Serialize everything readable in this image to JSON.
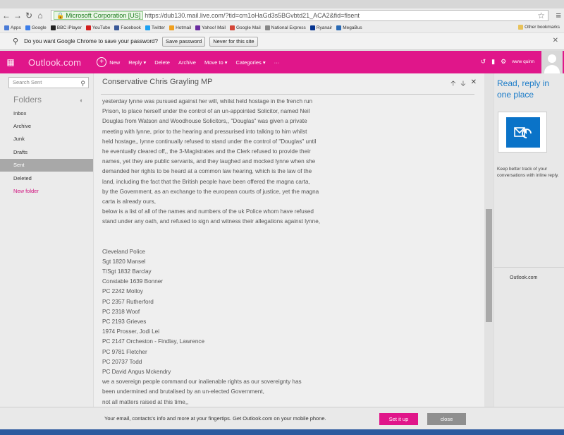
{
  "browser": {
    "ev_label": "Microsoft Corporation [US]",
    "url": "https://dub130.mail.live.com/?tid=cm1oHaGd3s5BGvbtd21_ACA2&fid=flsent",
    "bookmarks": [
      {
        "label": "Apps",
        "color": "#4a7bd6"
      },
      {
        "label": "Google",
        "color": "#3b7de8"
      },
      {
        "label": "BBC iPlayer",
        "color": "#222222"
      },
      {
        "label": "YouTube",
        "color": "#d21f1f"
      },
      {
        "label": "Facebook",
        "color": "#3b5998"
      },
      {
        "label": "Twitter",
        "color": "#1da1f2"
      },
      {
        "label": "Hotmail",
        "color": "#f0a020"
      },
      {
        "label": "Yahoo! Mail",
        "color": "#6a2ca0"
      },
      {
        "label": "Google Mail",
        "color": "#d44638"
      },
      {
        "label": "National Express",
        "color": "#888888"
      },
      {
        "label": "Ryanair",
        "color": "#073590"
      },
      {
        "label": "MegaBus",
        "color": "#2a6ab5"
      }
    ],
    "other_bookmarks": "Other bookmarks"
  },
  "password_bar": {
    "message": "Do you want Google Chrome to save your password?",
    "save_label": "Save password",
    "never_label": "Never for this site"
  },
  "outlook": {
    "brand": "Outlook.com",
    "commands": {
      "new": "New",
      "reply": "Reply",
      "delete": "Delete",
      "archive": "Archive",
      "move_to": "Move to",
      "categories": "Categories",
      "more": "···"
    },
    "user": "www quinn"
  },
  "sidebar": {
    "search_placeholder": "Search Sent",
    "folders_heading": "Folders",
    "items": [
      {
        "label": "Inbox"
      },
      {
        "label": "Archive"
      },
      {
        "label": "Junk"
      },
      {
        "label": "Drafts"
      },
      {
        "label": "Sent"
      },
      {
        "label": "Deleted"
      },
      {
        "label": "New folder"
      }
    ]
  },
  "message": {
    "subject": "Conservative Chris Grayling MP",
    "paragraph1": [
      "yesterday lynne was pursued against her will, whilst held hostage in the french run",
      "Prison, to place herself under the control of an un-appointed Solicitor, named Neil",
      "Douglas from Watson and Woodhouse Solicitors,, \"Douglas\" was given a private",
      "meeting with lynne, prior to the hearing and pressurised into talking to him whilst",
      "held hostage,, lynne continually refused to stand under the control of \"Douglas\" until",
      "he eventually cleared off,, the 3-Magistrates and the Clerk refused to provide their",
      "names, yet they are public servants, and they laughed and mocked lynne when she",
      "demanded her rights to be heard at a common law hearing, which is the law of the",
      "land, including the fact that the British people have been offered the magna carta,",
      "by the Government, as an exchange to the european courts of justice, yet the magna",
      "carta is already ours,",
      "below is a list of all of the names and numbers of the uk Police whom have refused",
      "stand under any oath, and refused to sign and witness their allegations against lynne,"
    ],
    "paragraph2": [
      "Cleveland Police",
      "Sgt 1820 Mansel",
      "T/Sgt 1832 Barclay",
      "Constable 1639 Bonner",
      "PC 2242 Molloy",
      "PC 2357 Rutherford",
      "PC 2318 Woof",
      "PC 2193 Grieves",
      "1974 Prosser, Jodi Lei",
      "PC 2147 Orcheston - Findlay, Lawrence",
      "PC 9781 Fletcher",
      "PC 20737 Todd",
      "PC David Angus Mckendry",
      "we a sovereign people command our inalienable rights as our sovereignty has",
      "been undermined and brutalised by an un-elected Government,",
      "not all matters raised at this time,,"
    ]
  },
  "ad": {
    "title": "Read, reply in one place",
    "text": "Keep better track of your conversations with inline reply.",
    "footer": "Outlook.com"
  },
  "notice": {
    "text": "Your email, contacts's info and more at your fingertips. Get Outlook.com on your mobile phone.",
    "setup_label": "Set it up",
    "close_label": "close"
  }
}
